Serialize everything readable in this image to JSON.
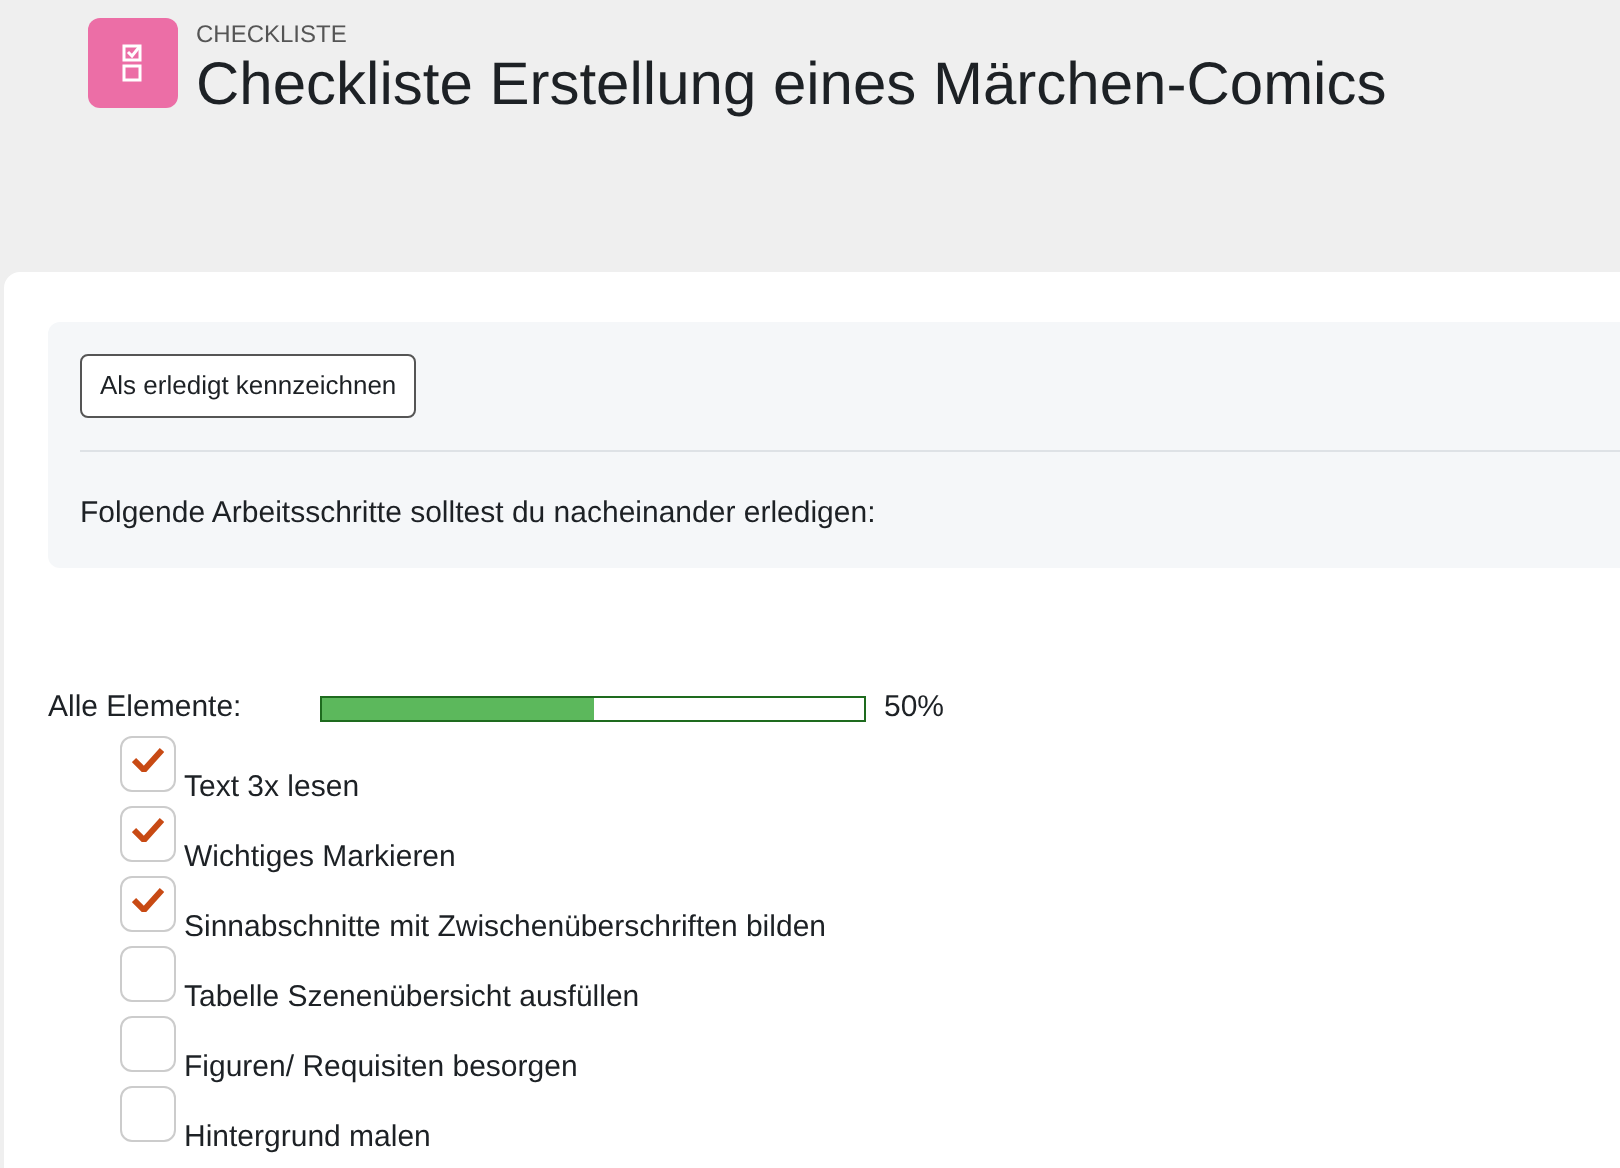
{
  "header": {
    "kicker": "CHECKLISTE",
    "title": "Checkliste Erstellung eines Märchen-Comics"
  },
  "panel": {
    "button": "Als erledigt kennzeichnen",
    "intro": "Folgende Arbeitsschritte solltest du nacheinander erledigen:"
  },
  "progress": {
    "label": "Alle Elemente:",
    "level": 0.5,
    "reading": "50%"
  },
  "items": [
    {
      "label": "Text 3x lesen",
      "checked": true
    },
    {
      "label": "Wichtiges Markieren",
      "checked": true
    },
    {
      "label": "Sinnabschnitte mit Zwischenüberschriften bilden",
      "checked": true
    },
    {
      "label": "Tabelle Szenenübersicht ausfüllen",
      "checked": false
    },
    {
      "label": "Figuren/ Requisiten besorgen",
      "checked": false
    },
    {
      "label": "Hintergrund malen",
      "checked": false
    }
  ]
}
